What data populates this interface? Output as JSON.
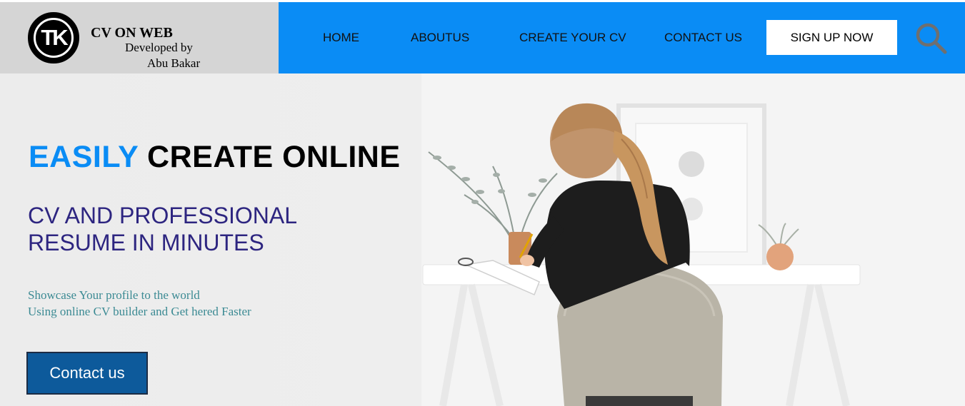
{
  "brand": {
    "logo_text": "TK",
    "title": "CV ON WEB",
    "developed_by": "Developed by",
    "author": "Abu Bakar"
  },
  "nav": {
    "items": [
      {
        "label": "HOME"
      },
      {
        "label": "ABOUTUS"
      },
      {
        "label": "CREATE YOUR CV"
      },
      {
        "label": "CONTACT US"
      }
    ],
    "signup_label": "SIGN UP NOW",
    "search_icon": "search-icon"
  },
  "hero": {
    "headline_accent": "EASILY",
    "headline_rest": "CREATE ONLINE",
    "subhead_line1": "CV AND PROFESSIONAL",
    "subhead_line2": "RESUME IN MINUTES",
    "tagline_line1": "Showcase Your profile to the world",
    "tagline_line2": "Using online CV builder and Get hered Faster",
    "contact_label": "Contact us",
    "image": "woman-writing-at-white-desk"
  },
  "colors": {
    "nav_background": "#0a8cf5",
    "brand_background": "#d5d5d5",
    "headline_accent": "#0a8cf5",
    "subhead": "#2d2580",
    "tagline": "#3b8a93",
    "contact_button": "#0d5a9b"
  }
}
